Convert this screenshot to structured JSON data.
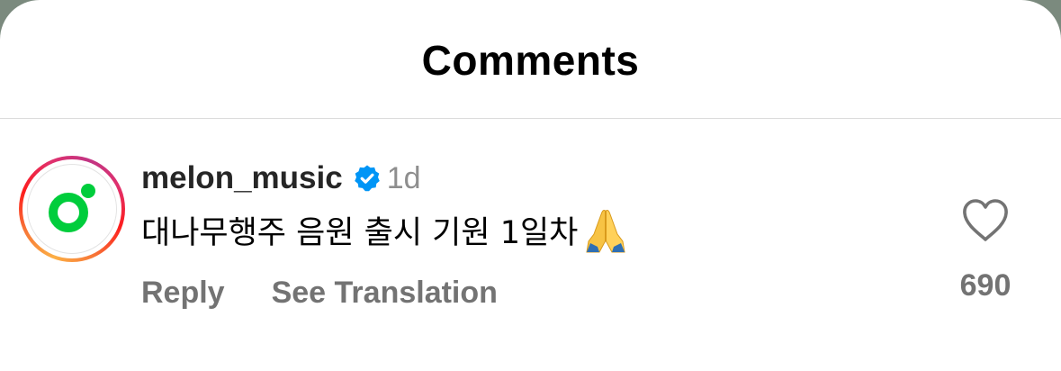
{
  "header": {
    "title": "Comments"
  },
  "comment": {
    "username": "melon_music",
    "verified_icon": "verified-badge-icon",
    "time": "1d",
    "text": "대나무행주 음원 출시 기원 1일차",
    "emoji": "folded-hands-icon",
    "reply_label": "Reply",
    "translation_label": "See Translation",
    "like_icon": "heart-outline-icon",
    "like_count": "690"
  },
  "colors": {
    "verified_blue": "#0095f6",
    "melon_green": "#00cd3c",
    "secondary_text": "#737373",
    "divider": "#dbdbdb"
  }
}
